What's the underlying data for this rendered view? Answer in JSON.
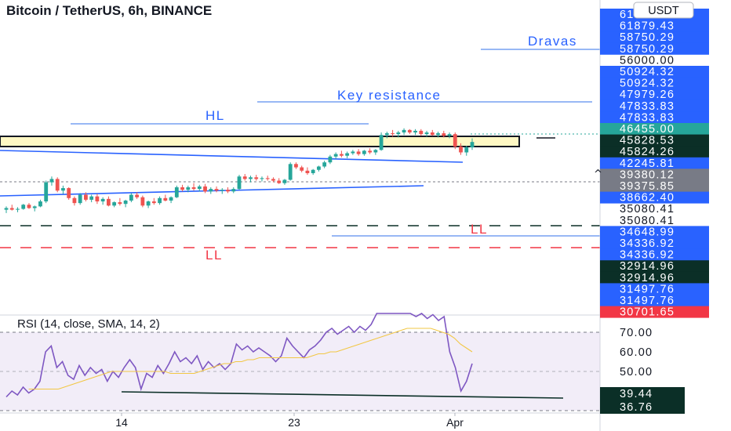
{
  "title": "Bitcoin / TetherUS, 6h, BINANCE",
  "currency": "USDT",
  "colors": {
    "up": "#26a69a",
    "down": "#ef5350",
    "accent_blue": "#2962ff",
    "dark_green_tag": "#0b2f27",
    "gray_tag": "#787b86",
    "rsi_line": "#7e57c2",
    "rsi_ma": "#f2c744",
    "zone_fill": "#fff8c4",
    "ll_red": "#f23645",
    "hl_blue": "#2962ff"
  },
  "annotations": {
    "hl": "HL",
    "key_resistance": "Key resistance",
    "dravas": "Dravas",
    "ll_top": "LL",
    "ll_bottom": "LL"
  },
  "price_tags": [
    {
      "text": "61879.43",
      "style": "blue"
    },
    {
      "text": "61879.43",
      "style": "blue"
    },
    {
      "text": "58750.29",
      "style": "blue"
    },
    {
      "text": "58750.29",
      "style": "blue"
    },
    {
      "text": "56000.00",
      "style": "plain"
    },
    {
      "text": "50924.32",
      "style": "blue"
    },
    {
      "text": "50924.32",
      "style": "blue"
    },
    {
      "text": "47979.26",
      "style": "blue"
    },
    {
      "text": "47833.83",
      "style": "blue"
    },
    {
      "text": "47833.83",
      "style": "blue"
    },
    {
      "text": "46455.00",
      "style": "green"
    },
    {
      "text": "45828.53",
      "style": "dark"
    },
    {
      "text": "45824.26",
      "style": "dark"
    },
    {
      "text": "42245.81",
      "style": "blue"
    },
    {
      "text": "39380.12",
      "style": "gray"
    },
    {
      "text": "39375.85",
      "style": "gray"
    },
    {
      "text": "38662.40",
      "style": "blue"
    },
    {
      "text": "35080.41",
      "style": "plain"
    },
    {
      "text": "35080.41",
      "style": "plain"
    },
    {
      "text": "34648.99",
      "style": "blue"
    },
    {
      "text": "34336.92",
      "style": "blue"
    },
    {
      "text": "34336.92",
      "style": "blue"
    },
    {
      "text": "32914.96",
      "style": "dark"
    },
    {
      "text": "32914.96",
      "style": "dark"
    },
    {
      "text": "31497.76",
      "style": "blue"
    },
    {
      "text": "31497.76",
      "style": "blue"
    },
    {
      "text": "30701.65",
      "style": "red"
    }
  ],
  "chart_data": [
    {
      "type": "candlestick",
      "title": "Bitcoin / TetherUS, 6h, BINANCE",
      "x_ticks": [
        "14",
        "23",
        "Apr"
      ],
      "series": [
        {
          "values": [
            [
              38300,
              38700,
              37900,
              38500
            ],
            [
              38500,
              38900,
              38200,
              38300
            ],
            [
              38300,
              38600,
              38000,
              38400
            ],
            [
              38400,
              39000,
              38300,
              38900
            ],
            [
              38900,
              39100,
              38400,
              38500
            ],
            [
              38500,
              38800,
              38100,
              38700
            ],
            [
              38700,
              39500,
              38600,
              39300
            ],
            [
              39300,
              41800,
              39100,
              41600
            ],
            [
              41600,
              42300,
              41200,
              42000
            ],
            [
              42000,
              42200,
              40400,
              40600
            ],
            [
              40600,
              41200,
              40200,
              40900
            ],
            [
              40900,
              41000,
              39500,
              39700
            ],
            [
              39700,
              39900,
              38800,
              39100
            ],
            [
              39100,
              40300,
              38900,
              40100
            ],
            [
              40100,
              40400,
              39300,
              39500
            ],
            [
              39500,
              40100,
              39200,
              39900
            ],
            [
              39900,
              40200,
              39000,
              39300
            ],
            [
              39300,
              39800,
              38900,
              39600
            ],
            [
              39600,
              39900,
              38700,
              38800
            ],
            [
              38800,
              39300,
              38600,
              39200
            ],
            [
              39200,
              39700,
              38800,
              39000
            ],
            [
              39000,
              39500,
              38600,
              39400
            ],
            [
              39400,
              40300,
              39200,
              40100
            ],
            [
              40100,
              40400,
              39600,
              39800
            ],
            [
              39800,
              40000,
              38600,
              38800
            ],
            [
              38800,
              39400,
              38500,
              39300
            ],
            [
              39300,
              39700,
              38900,
              39100
            ],
            [
              39100,
              39900,
              38900,
              39700
            ],
            [
              39700,
              40100,
              39300,
              39400
            ],
            [
              39400,
              39900,
              39100,
              39800
            ],
            [
              39800,
              41200,
              39700,
              41000
            ],
            [
              41000,
              41300,
              40500,
              40700
            ],
            [
              40700,
              41200,
              40400,
              41000
            ],
            [
              41000,
              41500,
              40600,
              40800
            ],
            [
              40800,
              41300,
              40500,
              41100
            ],
            [
              41100,
              41400,
              40300,
              40500
            ],
            [
              40500,
              41000,
              40200,
              40800
            ],
            [
              40800,
              41100,
              40400,
              40600
            ],
            [
              40600,
              40900,
              40200,
              40700
            ],
            [
              40700,
              41000,
              40300,
              40500
            ],
            [
              40500,
              41000,
              40300,
              40800
            ],
            [
              40800,
              42500,
              40700,
              42300
            ],
            [
              42300,
              42600,
              41800,
              42000
            ],
            [
              42000,
              42400,
              41600,
              42200
            ],
            [
              42200,
              42500,
              41800,
              42000
            ],
            [
              42000,
              42300,
              41700,
              42100
            ],
            [
              42100,
              42400,
              41800,
              42000
            ],
            [
              42000,
              42200,
              41600,
              41800
            ],
            [
              41800,
              42100,
              41400,
              41500
            ],
            [
              41500,
              42000,
              41300,
              41900
            ],
            [
              41900,
              44000,
              41800,
              43800
            ],
            [
              43800,
              44000,
              43200,
              43400
            ],
            [
              43400,
              43600,
              42800,
              43000
            ],
            [
              43000,
              43400,
              42500,
              42700
            ],
            [
              42700,
              43200,
              42500,
              43100
            ],
            [
              43100,
              43600,
              42900,
              43500
            ],
            [
              43500,
              44200,
              43300,
              44000
            ],
            [
              44000,
              44900,
              43800,
              44700
            ],
            [
              44700,
              45200,
              44400,
              45000
            ],
            [
              45000,
              45400,
              44600,
              44800
            ],
            [
              44800,
              45300,
              44500,
              45100
            ],
            [
              45100,
              45500,
              44900,
              45300
            ],
            [
              45300,
              45600,
              44800,
              45000
            ],
            [
              45000,
              45500,
              44800,
              45400
            ],
            [
              45400,
              45700,
              45000,
              45200
            ],
            [
              45200,
              45600,
              44900,
              45500
            ],
            [
              45500,
              47600,
              45400,
              47300
            ],
            [
              47300,
              47700,
              46900,
              47500
            ],
            [
              47500,
              47900,
              47100,
              47400
            ],
            [
              47400,
              47800,
              47000,
              47600
            ],
            [
              47600,
              48100,
              47300,
              47900
            ],
            [
              47900,
              48000,
              47400,
              47600
            ],
            [
              47600,
              48000,
              47300,
              47800
            ],
            [
              47800,
              48000,
              47200,
              47400
            ],
            [
              47400,
              47800,
              47100,
              47600
            ],
            [
              47600,
              47900,
              47200,
              47300
            ],
            [
              47300,
              47700,
              47000,
              47500
            ],
            [
              47500,
              47800,
              47000,
              47200
            ],
            [
              47200,
              47600,
              46900,
              47400
            ],
            [
              47400,
              47600,
              45600,
              45900
            ],
            [
              45900,
              46300,
              44900,
              45200
            ],
            [
              45200,
              46000,
              44800,
              45800
            ],
            [
              45800,
              46900,
              45500,
              46455
            ]
          ]
        }
      ]
    },
    {
      "type": "line",
      "title": "RSI (14, close, SMA, 14, 2)",
      "ylim": [
        30,
        70
      ],
      "y_ticks": [
        "70.00",
        "60.00",
        "50.00"
      ],
      "value_tags": [
        "39.44",
        "36.76"
      ],
      "series": [
        {
          "values": [
            37,
            40,
            38,
            42,
            39,
            41,
            45,
            60,
            63,
            52,
            55,
            48,
            46,
            53,
            48,
            52,
            49,
            51,
            45,
            50,
            47,
            52,
            56,
            52,
            41,
            49,
            47,
            53,
            49,
            54,
            60,
            55,
            57,
            54,
            58,
            51,
            55,
            52,
            54,
            51,
            54,
            64,
            61,
            63,
            60,
            62,
            60,
            58,
            55,
            58,
            67,
            63,
            60,
            57,
            61,
            63,
            66,
            70,
            72,
            69,
            71,
            73,
            70,
            73,
            71,
            74,
            84,
            82,
            80,
            82,
            84,
            80,
            81,
            78,
            80,
            77,
            79,
            76,
            78,
            60,
            52,
            40,
            45,
            54
          ]
        },
        {
          "values": [
            41,
            41,
            41,
            41,
            41,
            41,
            42,
            43,
            44,
            45,
            46,
            47,
            48,
            49,
            50,
            50,
            50,
            50,
            50,
            50,
            50,
            50,
            50,
            50,
            49,
            49,
            49,
            49,
            49,
            50,
            51,
            52,
            53,
            54,
            54,
            55,
            55,
            56,
            56,
            57,
            57,
            57,
            57,
            57,
            57,
            57,
            57,
            57,
            58,
            59,
            59,
            60,
            60,
            61,
            62,
            63,
            64,
            65,
            66,
            67,
            68,
            69,
            70,
            71,
            72,
            72,
            72,
            72,
            72,
            71,
            70,
            69,
            67,
            64,
            62,
            60
          ]
        }
      ]
    }
  ]
}
